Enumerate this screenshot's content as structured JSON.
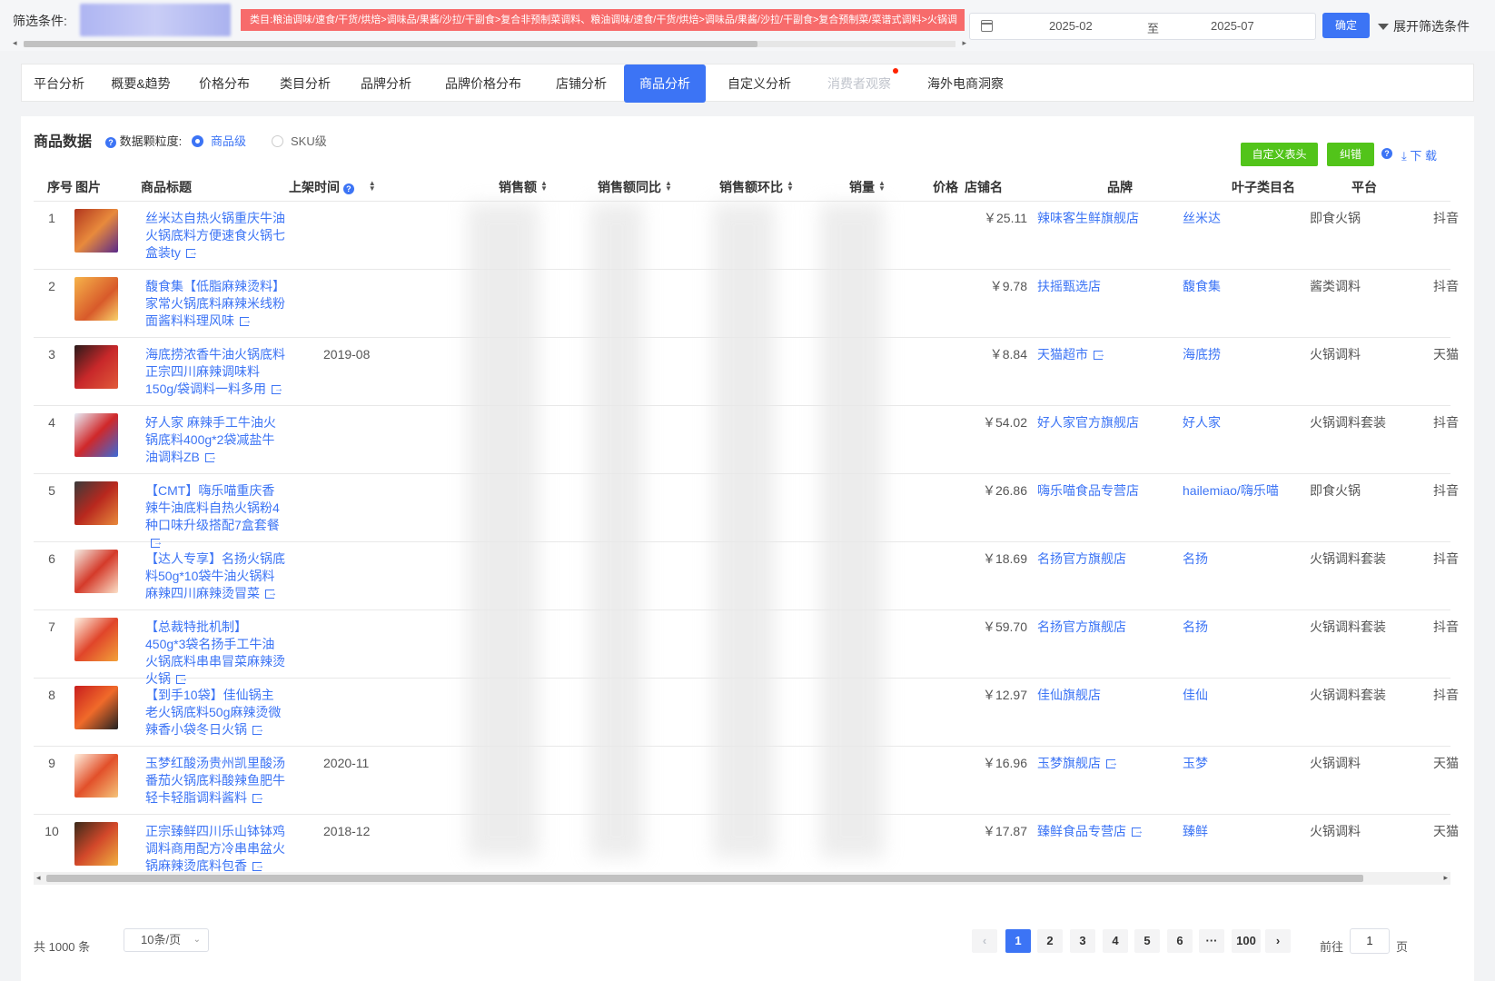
{
  "filter": {
    "label": "筛选条件:",
    "tag": "类目:粮油调味/速食/干货/烘焙>调味品/果酱/沙拉/干副食>复合非预制菜调料、粮油调味/速食/干货/烘焙>调味品/果酱/沙拉/干副食>复合预制菜/菜谱式调料>火锅调",
    "date_start": "2025-02",
    "date_sep": "至",
    "date_end": "2025-07",
    "confirm": "确定",
    "expand": "展开筛选条件"
  },
  "tabs": [
    {
      "label": "平台分析"
    },
    {
      "label": "概要&趋势"
    },
    {
      "label": "价格分布"
    },
    {
      "label": "类目分析"
    },
    {
      "label": "品牌分析"
    },
    {
      "label": "品牌价格分布"
    },
    {
      "label": "店铺分析"
    },
    {
      "label": "商品分析"
    },
    {
      "label": "自定义分析"
    },
    {
      "label": "消费者观察"
    },
    {
      "label": "海外电商洞察"
    }
  ],
  "section": {
    "title": "商品数据",
    "granularity_label": "数据颗粒度:",
    "option_product": "商品级",
    "option_sku": "SKU级",
    "custom_header": "自定义表头",
    "fix": "纠错",
    "download": "下 载"
  },
  "columns": {
    "idx": "序号",
    "img": "图片",
    "title": "商品标题",
    "date": "上架时间",
    "sales": "销售额",
    "yoy": "销售额同比",
    "mom": "销售额环比",
    "volume": "销量",
    "price": "价格",
    "store": "店铺名",
    "brand": "品牌",
    "leaf": "叶子类目名",
    "platform": "平台"
  },
  "rows": [
    {
      "idx": "1",
      "title": "丝米达自热火锅重庆牛油火锅底料方便速食火锅七盒装ty",
      "date": "",
      "price": "￥25.11",
      "store": "辣味客生鲜旗舰店",
      "brand": "丝米达",
      "leaf": "即食火锅",
      "platform": "抖音"
    },
    {
      "idx": "2",
      "title": "馥食集【低脂麻辣烫料】家常火锅底料麻辣米线粉面酱料料理风味",
      "date": "",
      "price": "￥9.78",
      "store": "扶摇甄选店",
      "brand": "馥食集",
      "leaf": "酱类调料",
      "platform": "抖音"
    },
    {
      "idx": "3",
      "title": "海底捞浓香牛油火锅底料正宗四川麻辣调味料150g/袋调料一料多用",
      "date": "2019-08",
      "price": "￥8.84",
      "store": "天猫超市",
      "brand": "海底捞",
      "leaf": "火锅调料",
      "platform": "天猫"
    },
    {
      "idx": "4",
      "title": "好人家 麻辣手工牛油火锅底料400g*2袋减盐牛油调料ZB",
      "date": "",
      "price": "￥54.02",
      "store": "好人家官方旗舰店",
      "brand": "好人家",
      "leaf": "火锅调料套装",
      "platform": "抖音"
    },
    {
      "idx": "5",
      "title": "【CMT】嗨乐喵重庆香辣牛油底料自热火锅粉4种口味升级搭配7盒套餐",
      "date": "",
      "price": "￥26.86",
      "store": "嗨乐喵食品专营店",
      "brand": "hailemiao/嗨乐喵",
      "leaf": "即食火锅",
      "platform": "抖音"
    },
    {
      "idx": "6",
      "title": "【达人专享】名扬火锅底料50g*10袋牛油火锅料麻辣四川麻辣烫冒菜",
      "date": "",
      "price": "￥18.69",
      "store": "名扬官方旗舰店",
      "brand": "名扬",
      "leaf": "火锅调料套装",
      "platform": "抖音"
    },
    {
      "idx": "7",
      "title": "【总裁特批机制】450g*3袋名扬手工牛油火锅底料串串冒菜麻辣烫火锅",
      "date": "",
      "price": "￥59.70",
      "store": "名扬官方旗舰店",
      "brand": "名扬",
      "leaf": "火锅调料套装",
      "platform": "抖音"
    },
    {
      "idx": "8",
      "title": "【到手10袋】佳仙锅主老火锅底料50g麻辣烫微辣香小袋冬日火锅",
      "date": "",
      "price": "￥12.97",
      "store": "佳仙旗舰店",
      "brand": "佳仙",
      "leaf": "火锅调料套装",
      "platform": "抖音"
    },
    {
      "idx": "9",
      "title": "玉梦红酸汤贵州凯里酸汤番茄火锅底料酸辣鱼肥牛轻卡轻脂调料酱料",
      "date": "2020-11",
      "price": "￥16.96",
      "store": "玉梦旗舰店",
      "brand": "玉梦",
      "leaf": "火锅调料",
      "platform": "天猫"
    },
    {
      "idx": "10",
      "title": "正宗臻鲜四川乐山钵钵鸡调料商用配方冷串串盆火锅麻辣烫底料包香",
      "date": "2018-12",
      "price": "￥17.87",
      "store": "臻鲜食品专营店",
      "brand": "臻鲜",
      "leaf": "火锅调料",
      "platform": "天猫"
    }
  ],
  "footer": {
    "total": "共 1000 条",
    "page_size": "10条/页",
    "pages": [
      "1",
      "2",
      "3",
      "4",
      "5",
      "6",
      "···",
      "100"
    ],
    "goto_label": "前往",
    "goto_value": "1",
    "goto_suffix": "页"
  },
  "colors": {
    "accent": "#3c74f5",
    "success": "#52c41a",
    "tag_red": "#f76b6b"
  }
}
